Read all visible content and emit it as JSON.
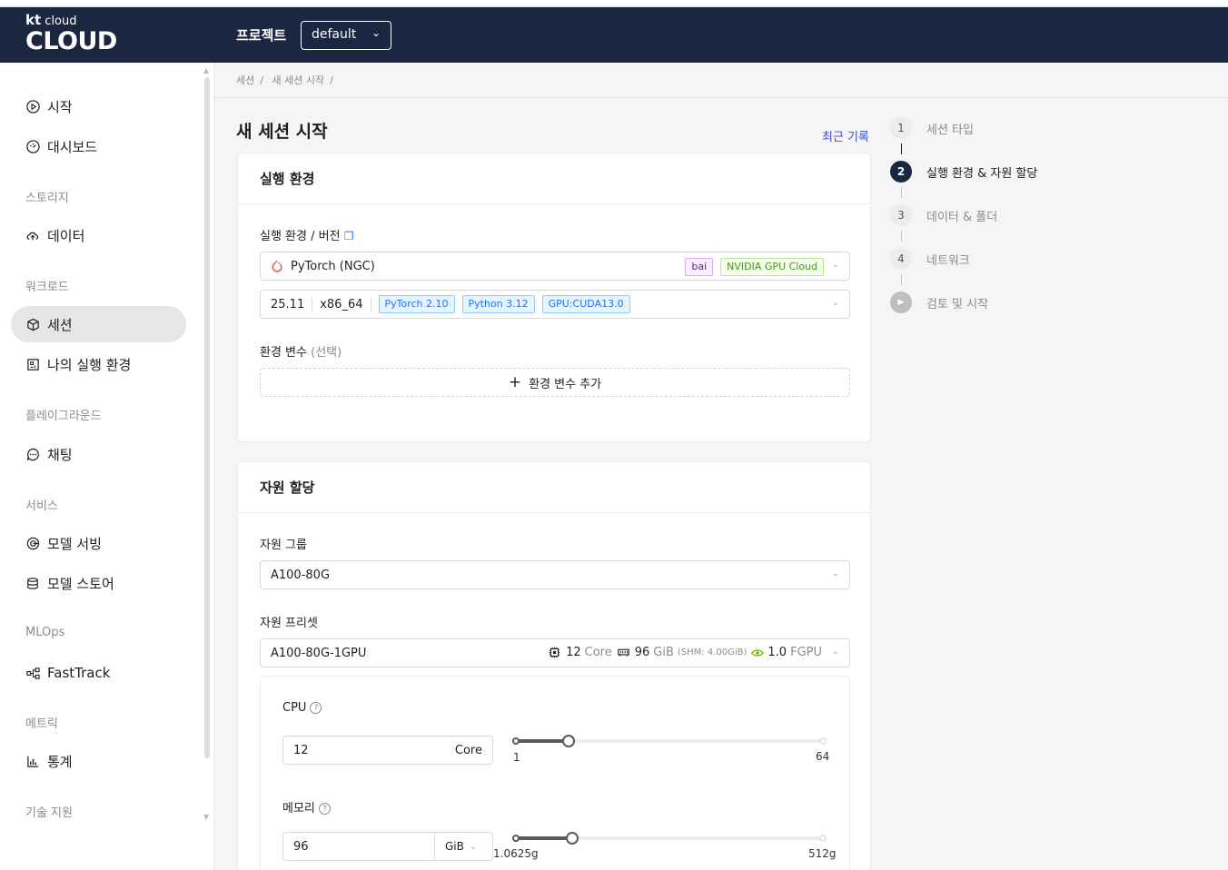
{
  "header": {
    "logo_small": "cloud",
    "logo_small_bold": "kt",
    "logo_big": "CLOUD",
    "project_label": "프로젝트",
    "project_value": "default"
  },
  "sidebar": {
    "items": [
      {
        "label": "시작",
        "icon": "play-circle-icon"
      },
      {
        "label": "대시보드",
        "icon": "dashboard-icon"
      },
      {
        "label": "데이터",
        "icon": "cloud-upload-icon"
      },
      {
        "label": "세션",
        "icon": "cube-icon"
      },
      {
        "label": "나의 실행 환경",
        "icon": "environment-icon"
      },
      {
        "label": "채팅",
        "icon": "chat-icon"
      },
      {
        "label": "모델 서빙",
        "icon": "model-serving-icon"
      },
      {
        "label": "모델 스토어",
        "icon": "database-icon"
      },
      {
        "label": "FastTrack",
        "icon": "workflow-icon"
      },
      {
        "label": "통계",
        "icon": "bar-chart-icon"
      }
    ],
    "groups": [
      "스토리지",
      "워크로드",
      "플레이그라운드",
      "서비스",
      "MLOps",
      "메트릭",
      "기술 지원"
    ]
  },
  "breadcrumb": [
    "세션",
    "새 세션 시작"
  ],
  "page_title": "새 세션 시작",
  "recent_link": "최근 기록",
  "env_card": {
    "title": "실행 환경",
    "env_label": "실행 환경 / 버전",
    "env_value": "PyTorch (NGC)",
    "env_tags": [
      "bai",
      "NVIDIA GPU Cloud"
    ],
    "version": "25.11",
    "arch": "x86_64",
    "version_tags": [
      "PyTorch 2.10",
      "Python 3.12",
      "GPU:CUDA13.0"
    ],
    "envvar_label": "환경 변수",
    "envvar_optional": "(선택)",
    "envvar_add": "환경 변수 추가"
  },
  "resource_card": {
    "title": "자원 할당",
    "group_label": "자원 그룹",
    "group_value": "A100-80G",
    "preset_label": "자원 프리셋",
    "preset_value": "A100-80G-1GPU",
    "preset_cpu": "12",
    "preset_cpu_unit": "Core",
    "preset_mem": "96",
    "preset_mem_unit": "GiB",
    "preset_shm": "(SHM: 4.00GiB)",
    "preset_gpu": "1.0",
    "preset_gpu_unit": "FGPU",
    "cpu_label": "CPU",
    "cpu_value": "12",
    "cpu_unit": "Core",
    "cpu_min": "1",
    "cpu_max": "64",
    "cpu_slider_fraction": 0.1746,
    "mem_label": "메모리",
    "mem_value": "96",
    "mem_unit": "GiB",
    "mem_min": "1.0625g",
    "mem_max": "512g",
    "mem_slider_fraction": 0.1856
  },
  "steps": [
    {
      "num": "1",
      "label": "세션 타입"
    },
    {
      "num": "2",
      "label": "실행 환경 & 자원 할당"
    },
    {
      "num": "3",
      "label": "데이터 & 폴더"
    },
    {
      "num": "4",
      "label": "네트워크"
    },
    {
      "num": "▶",
      "label": "검토 및 시작"
    }
  ]
}
